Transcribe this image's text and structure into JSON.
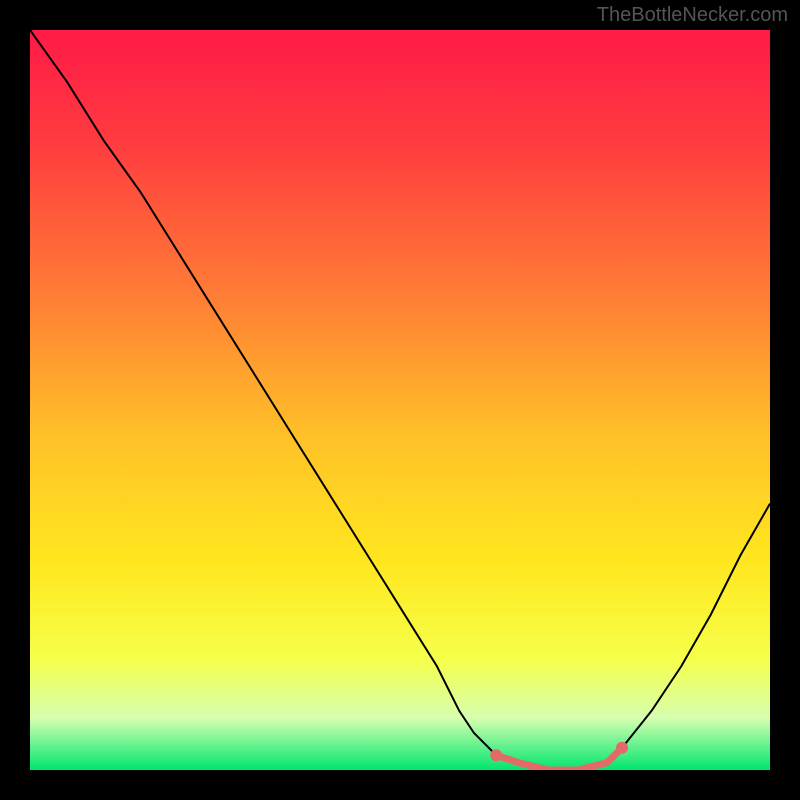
{
  "watermark": "TheBottleNecker.com",
  "chart_data": {
    "type": "line",
    "title": "",
    "xlabel": "",
    "ylabel": "",
    "xlim": [
      0,
      100
    ],
    "ylim": [
      0,
      100
    ],
    "background_gradient": {
      "stops": [
        {
          "offset": 0,
          "color": "#ff1a47"
        },
        {
          "offset": 15,
          "color": "#ff3b3f"
        },
        {
          "offset": 35,
          "color": "#ff7a36"
        },
        {
          "offset": 55,
          "color": "#ffc128"
        },
        {
          "offset": 72,
          "color": "#ffe71e"
        },
        {
          "offset": 85,
          "color": "#f5ff4a"
        },
        {
          "offset": 93,
          "color": "#d6ffb0"
        },
        {
          "offset": 100,
          "color": "#00e66e"
        }
      ]
    },
    "series": [
      {
        "name": "bottleneck-curve",
        "color": "#000000",
        "x": [
          0,
          5,
          10,
          15,
          20,
          25,
          30,
          35,
          40,
          45,
          50,
          55,
          58,
          60,
          63,
          66,
          70,
          74,
          78,
          80,
          84,
          88,
          92,
          96,
          100
        ],
        "y": [
          100,
          93,
          85,
          78,
          70,
          62,
          54,
          46,
          38,
          30,
          22,
          14,
          8,
          5,
          2,
          1,
          0,
          0,
          1,
          3,
          8,
          14,
          21,
          29,
          36
        ]
      }
    ],
    "highlight": {
      "name": "sweet-spot",
      "color": "#e46a6a",
      "dot_radius": 6,
      "line_width": 7,
      "x": [
        63,
        66,
        70,
        74,
        78,
        80
      ],
      "y": [
        2,
        1,
        0,
        0,
        1,
        3
      ]
    }
  }
}
